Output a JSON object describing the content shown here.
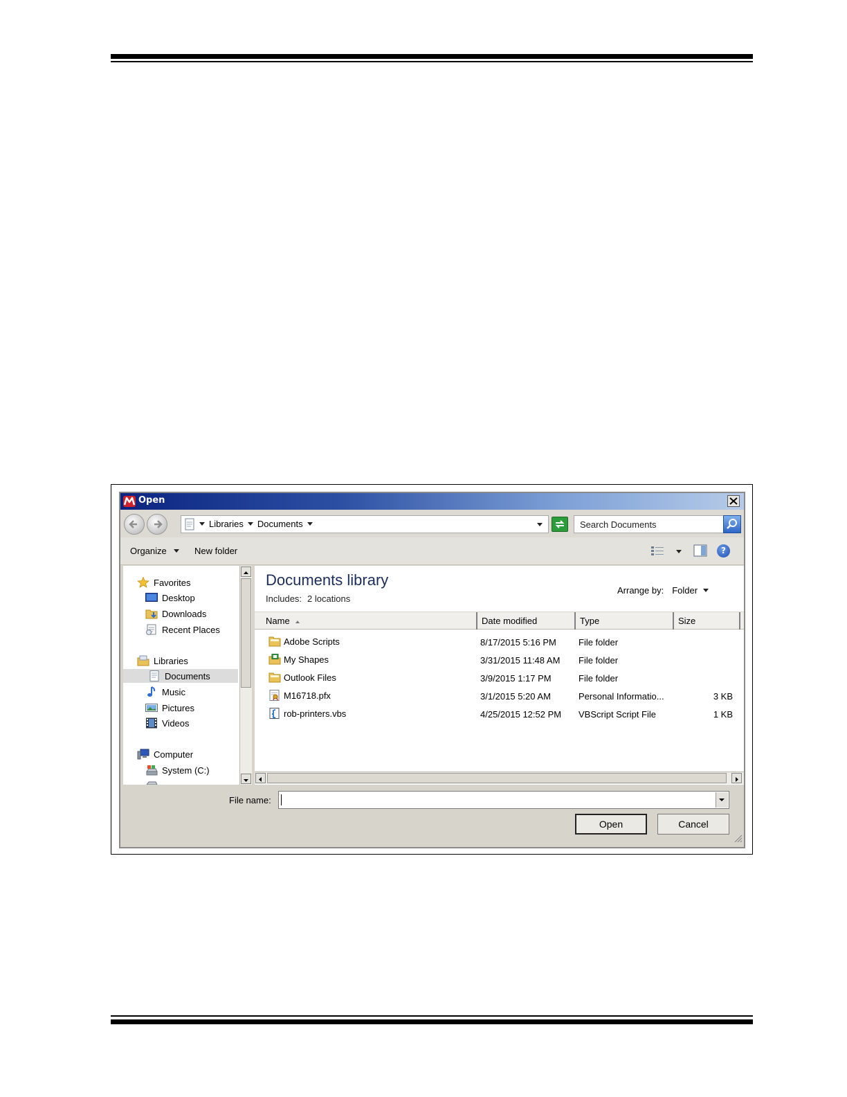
{
  "dialog": {
    "title": "Open",
    "address": {
      "crumbs": [
        "Libraries",
        "Documents"
      ]
    },
    "search": {
      "placeholder": "Search Documents"
    },
    "toolbar": {
      "organize_label": "Organize",
      "new_folder_label": "New folder",
      "help_label": "?"
    },
    "nav": {
      "favorites": "Favorites",
      "desktop": "Desktop",
      "downloads": "Downloads",
      "recent": "Recent Places",
      "libraries": "Libraries",
      "documents": "Documents",
      "music": "Music",
      "pictures": "Pictures",
      "videos": "Videos",
      "computer": "Computer",
      "system": "System (C:)"
    },
    "library": {
      "title": "Documents library",
      "includes_label": "Includes:",
      "includes_value": "2 locations",
      "arrange_label": "Arrange by:",
      "arrange_value": "Folder"
    },
    "columns": {
      "name": "Name",
      "date": "Date modified",
      "type": "Type",
      "size": "Size"
    },
    "files": [
      {
        "name": "Adobe Scripts",
        "date": "8/17/2015 5:16 PM",
        "type": "File folder",
        "size": "",
        "icon": "folder-icon"
      },
      {
        "name": "My Shapes",
        "date": "3/31/2015 11:48 AM",
        "type": "File folder",
        "size": "",
        "icon": "shapes-folder-icon"
      },
      {
        "name": "Outlook Files",
        "date": "3/9/2015 1:17 PM",
        "type": "File folder",
        "size": "",
        "icon": "folder-icon"
      },
      {
        "name": "M16718.pfx",
        "date": "3/1/2015 5:20 AM",
        "type": "Personal Informatio...",
        "size": "3 KB",
        "icon": "certificate-file-icon"
      },
      {
        "name": "rob-printers.vbs",
        "date": "4/25/2015 12:52 PM",
        "type": "VBScript Script File",
        "size": "1 KB",
        "icon": "script-file-icon"
      }
    ],
    "file_name_label": "File name:",
    "file_name_value": "",
    "open_label": "Open",
    "cancel_label": "Cancel"
  },
  "colors": {
    "title_gradient_start": "#0b2480",
    "title_gradient_end": "#b6cbe9",
    "dialog_bg": "#d7d4cb",
    "library_title": "#1b2d5a"
  }
}
